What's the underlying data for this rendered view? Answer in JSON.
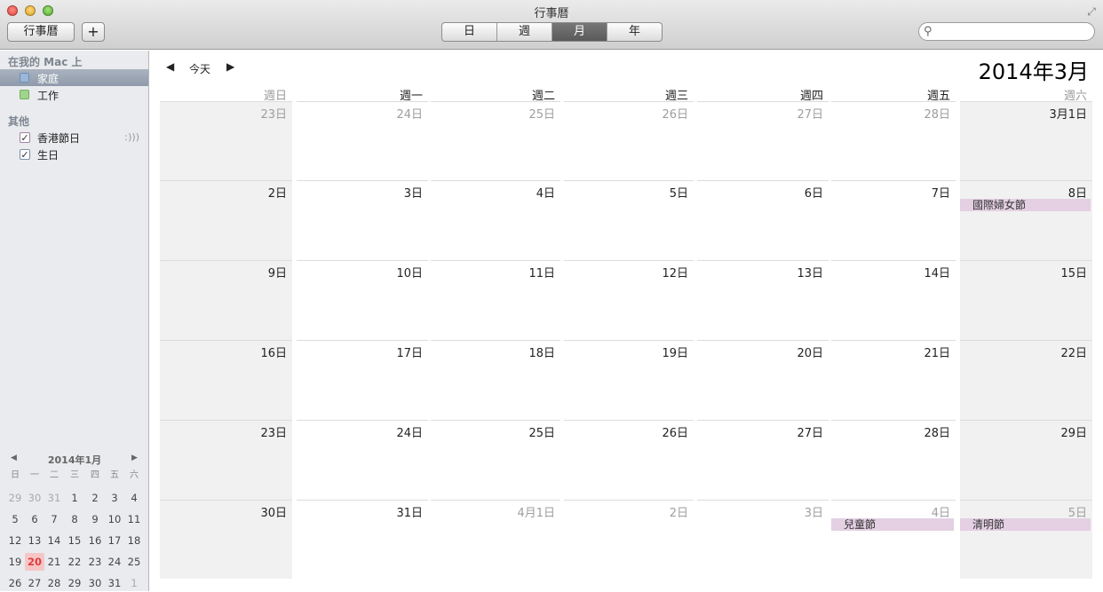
{
  "window": {
    "title": "行事曆"
  },
  "toolbar": {
    "calendars_label": "行事曆",
    "add_label": "+",
    "views": [
      {
        "label": "日",
        "active": false
      },
      {
        "label": "週",
        "active": false
      },
      {
        "label": "月",
        "active": true
      },
      {
        "label": "年",
        "active": false
      }
    ],
    "search_placeholder": ""
  },
  "sidebar": {
    "sections": [
      {
        "title": "在我的 Mac 上",
        "items": [
          {
            "label": "家庭",
            "color": "#9ab6d8",
            "selected": true,
            "type": "swatch"
          },
          {
            "label": "工作",
            "color": "#9fd58a",
            "selected": false,
            "type": "swatch"
          }
        ]
      },
      {
        "title": "其他",
        "items": [
          {
            "label": "香港節日",
            "color": "#c9a6c7",
            "selected": false,
            "type": "check",
            "feed": true
          },
          {
            "label": "生日",
            "color": "#b9c6d6",
            "selected": false,
            "type": "check",
            "feed": false
          }
        ]
      }
    ]
  },
  "mini_calendar": {
    "title": "2014年1月",
    "weekdays": [
      "日",
      "一",
      "二",
      "三",
      "四",
      "五",
      "六"
    ],
    "weeks": [
      [
        {
          "d": "29",
          "o": true
        },
        {
          "d": "30",
          "o": true
        },
        {
          "d": "31",
          "o": true
        },
        {
          "d": "1"
        },
        {
          "d": "2"
        },
        {
          "d": "3"
        },
        {
          "d": "4"
        }
      ],
      [
        {
          "d": "5"
        },
        {
          "d": "6"
        },
        {
          "d": "7"
        },
        {
          "d": "8"
        },
        {
          "d": "9"
        },
        {
          "d": "10"
        },
        {
          "d": "11"
        }
      ],
      [
        {
          "d": "12"
        },
        {
          "d": "13"
        },
        {
          "d": "14"
        },
        {
          "d": "15"
        },
        {
          "d": "16"
        },
        {
          "d": "17"
        },
        {
          "d": "18"
        }
      ],
      [
        {
          "d": "19"
        },
        {
          "d": "20",
          "t": true
        },
        {
          "d": "21"
        },
        {
          "d": "22"
        },
        {
          "d": "23"
        },
        {
          "d": "24"
        },
        {
          "d": "25"
        }
      ],
      [
        {
          "d": "26"
        },
        {
          "d": "27"
        },
        {
          "d": "28"
        },
        {
          "d": "29"
        },
        {
          "d": "30"
        },
        {
          "d": "31"
        },
        {
          "d": "1",
          "o": true
        }
      ]
    ]
  },
  "main": {
    "today_label": "今天",
    "month_title": "2014年3月",
    "weekdays": [
      "週日",
      "週一",
      "週二",
      "週三",
      "週四",
      "週五",
      "週六"
    ],
    "weeks": [
      [
        {
          "d": "23日",
          "m": true
        },
        {
          "d": "24日",
          "m": true
        },
        {
          "d": "25日",
          "m": true
        },
        {
          "d": "26日",
          "m": true
        },
        {
          "d": "27日",
          "m": true
        },
        {
          "d": "28日",
          "m": true
        },
        {
          "d": "3月1日"
        }
      ],
      [
        {
          "d": "2日"
        },
        {
          "d": "3日"
        },
        {
          "d": "4日"
        },
        {
          "d": "5日"
        },
        {
          "d": "6日"
        },
        {
          "d": "7日"
        },
        {
          "d": "8日",
          "e": "國際婦女節"
        }
      ],
      [
        {
          "d": "9日"
        },
        {
          "d": "10日"
        },
        {
          "d": "11日"
        },
        {
          "d": "12日"
        },
        {
          "d": "13日"
        },
        {
          "d": "14日"
        },
        {
          "d": "15日"
        }
      ],
      [
        {
          "d": "16日"
        },
        {
          "d": "17日"
        },
        {
          "d": "18日"
        },
        {
          "d": "19日"
        },
        {
          "d": "20日"
        },
        {
          "d": "21日"
        },
        {
          "d": "22日"
        }
      ],
      [
        {
          "d": "23日"
        },
        {
          "d": "24日"
        },
        {
          "d": "25日"
        },
        {
          "d": "26日"
        },
        {
          "d": "27日"
        },
        {
          "d": "28日"
        },
        {
          "d": "29日"
        }
      ],
      [
        {
          "d": "30日"
        },
        {
          "d": "31日"
        },
        {
          "d": "4月1日",
          "m": true
        },
        {
          "d": "2日",
          "m": true
        },
        {
          "d": "3日",
          "m": true
        },
        {
          "d": "4日",
          "m": true,
          "e": "兒童節"
        },
        {
          "d": "5日",
          "m": true,
          "e": "清明節"
        }
      ]
    ],
    "event_color": "#e4cfe3"
  }
}
